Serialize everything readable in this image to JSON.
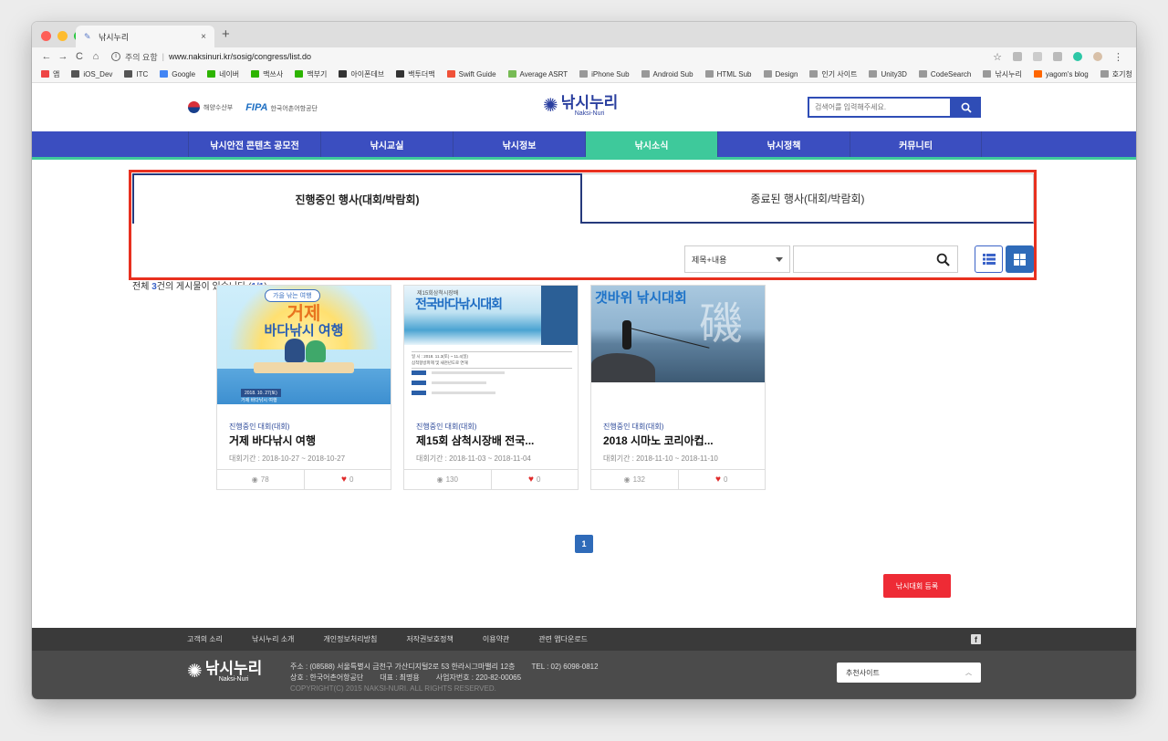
{
  "browser": {
    "tab_title": "낚시누리",
    "tab_close": "×",
    "new_tab": "+",
    "security_label": "주의 요함",
    "url": "www.naksinuri.kr/sosig/congress/list.do",
    "bookmarks": [
      "앱",
      "iOS_Dev",
      "ITC",
      "Google",
      "네이버",
      "맥쓰사",
      "맥부기",
      "아이폰데브",
      "백투더맥",
      "Swift Guide",
      "Average ASRT",
      "iPhone Sub",
      "Android Sub",
      "HTML Sub",
      "Design",
      "인기 사이트",
      "Unity3D",
      "CodeSearch",
      "낚시누리",
      "yagom's blog",
      "호기청"
    ],
    "bookmarks_more": "»"
  },
  "header": {
    "gov_name": "해양수산부",
    "fipa_logo": "FIPA",
    "fipa_name": "한국어촌어항공단",
    "logo_main": "낚시누리",
    "logo_sub": "Naksi-Nuri",
    "search_placeholder": "검색어를 입력해주세요."
  },
  "gnb": {
    "items": [
      "낚시안전 콘텐츠 공모전",
      "낚시교실",
      "낚시정보",
      "낚시소식",
      "낚시정책",
      "커뮤니티"
    ],
    "active_index": 3
  },
  "event_tabs": {
    "active": "진행중인 행사(대회/박람회)",
    "inactive": "종료된 행사(대회/박람회)"
  },
  "list_info": {
    "prefix": "전체 ",
    "count": "3",
    "suffix": "건의 게시물이 있습니다.(",
    "page": "1/1",
    "close": ")"
  },
  "filter": {
    "select_value": "제목+내용",
    "keyword": ""
  },
  "cards": [
    {
      "category": "진행중인 대회(대회)",
      "title": "거제 바다낚시 여행",
      "period": "대회기간 : 2018-10-27 ~ 2018-10-27",
      "views": "78",
      "likes": "0",
      "poster": {
        "top": "가을 낚는 여행",
        "big1": "거제",
        "big2": "바다낚시 여행",
        "line1": "2018. 10. 27(토)",
        "line2": "거제 바다낚시 여행"
      }
    },
    {
      "category": "진행중인 대회(대회)",
      "title": "제15회 삼척시장배 전국...",
      "period": "대회기간 : 2018-11-03 ~ 2018-11-04",
      "views": "130",
      "likes": "0",
      "poster": {
        "top": "제15회삼척시장배",
        "big1": "전국바다낚시대회",
        "line1": "일 시 : 2018. 11.3(토) ~ 11.4(일)",
        "line2": "삼척항방파제 및 새천년도로 연해"
      }
    },
    {
      "category": "진행중인 대회(대회)",
      "title": "2018 시마노 코리아컵...",
      "period": "대회기간 : 2018-11-10 ~ 2018-11-10",
      "views": "132",
      "likes": "0",
      "poster": {
        "top": "갯바위 낚시대회",
        "big1": "磯"
      }
    }
  ],
  "pagination": {
    "current": "1"
  },
  "register_button": "낚시대회 등록",
  "footer": {
    "links": [
      "고객의 소리",
      "낚시누리 소개",
      "개인정보처리방침",
      "저작권보호정책",
      "이용약관",
      "관련 앱다운로드"
    ],
    "address": "주소 : (08588) 서울특별시 금천구 가산디지털2로 53 한라시그마밸리 12층",
    "tel": "TEL : 02) 6098-0812",
    "company": "상호 : 한국어촌어항공단",
    "ceo": "대표 : 최명용",
    "bizno": "사업자번호 : 220-82-00065",
    "copyright": "COPYRIGHT(C) 2015 NAKSI-NURI. ALL RIGHTS RESERVED.",
    "related_sites": "추천사이트",
    "facebook_icon": "f"
  },
  "colors": {
    "primary": "#3b4ec0",
    "accent": "#3ec99b",
    "highlight": "#e8301f",
    "button_red": "#ee2b35"
  }
}
